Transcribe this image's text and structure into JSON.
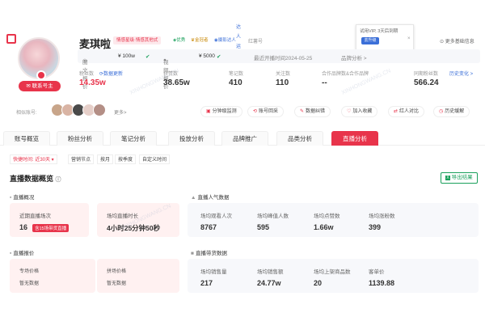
{
  "profile": {
    "name": "麦琪啦",
    "tags": [
      "情感星级·情感其他式",
      "优秀",
      "金冠者",
      "摄影达人"
    ],
    "account_label": "红薯号",
    "contact_button": "联系号主",
    "more_accounts": "更多基础信息"
  },
  "popup": {
    "text": "试用VIP, 3天后到期",
    "button": "去升级",
    "close": "×"
  },
  "vertical_menu": [
    "达",
    "人",
    "运",
    "营"
  ],
  "prices": {
    "image_label": "图文报价",
    "image_value": "¥ 100w",
    "video_label": "视频报价",
    "video_value": "¥ 5000",
    "update_label": "最近开播时间2024-05-25",
    "brand_label": "品牌分析 >"
  },
  "stats": [
    {
      "label": "粉丝数",
      "value": "14.35w",
      "extra": "数据更新"
    },
    {
      "label": "获赞数",
      "value": "38.65w"
    },
    {
      "label": "笔记数",
      "value": "410"
    },
    {
      "label": "关注数",
      "value": "110"
    },
    {
      "label": "合作品牌数&合作品牌",
      "value": "--"
    },
    {
      "label": "同期粉丝数",
      "value": "566.24",
      "extra": "历史变化 >"
    }
  ],
  "related": {
    "label": "相似账号:",
    "more": "更多>"
  },
  "actions": [
    "分钟级监测",
    "账号回采",
    "数据纠错",
    "加入收藏",
    "红人对比",
    "历史缓解"
  ],
  "tabs": [
    "账号概览",
    "粉丝分析",
    "笔记分析",
    "投放分析",
    "品牌推广",
    "品类分析",
    "直播分析"
  ],
  "filters": [
    "快捷时间: 近30天 ▾",
    "营销节点",
    "按月",
    "按季度",
    "自定义时间"
  ],
  "section": {
    "title": "直播数据概览",
    "export": "导出结果"
  },
  "live_overview": {
    "title": "直播概况",
    "card1_label": "近期直播场次",
    "card1_value": "16",
    "card1_badge": "含15场带货直播",
    "card2_label": "场均直播时长",
    "card2_value": "4小时25分钟50秒"
  },
  "popularity": {
    "title": "直播人气数据",
    "items": [
      {
        "label": "场均观看人次",
        "value": "8767"
      },
      {
        "label": "场均峰值人数",
        "value": "595"
      },
      {
        "label": "场均点赞数",
        "value": "1.66w"
      },
      {
        "label": "场均涨粉数",
        "value": "399"
      }
    ]
  },
  "price_section": {
    "title": "直播报价",
    "card1_label": "专场价格",
    "card1_value": "暂无数据",
    "card2_label": "拼场价格",
    "card2_value": "暂无数据"
  },
  "sales": {
    "title": "直播带货数据",
    "items": [
      {
        "label": "场均销售量",
        "value": "217"
      },
      {
        "label": "场均销售额",
        "value": "24.77w"
      },
      {
        "label": "场均上架商品数",
        "value": "20"
      },
      {
        "label": "客单价",
        "value": "1139.88"
      }
    ]
  },
  "watermark": "XINHONGWANG.CN"
}
